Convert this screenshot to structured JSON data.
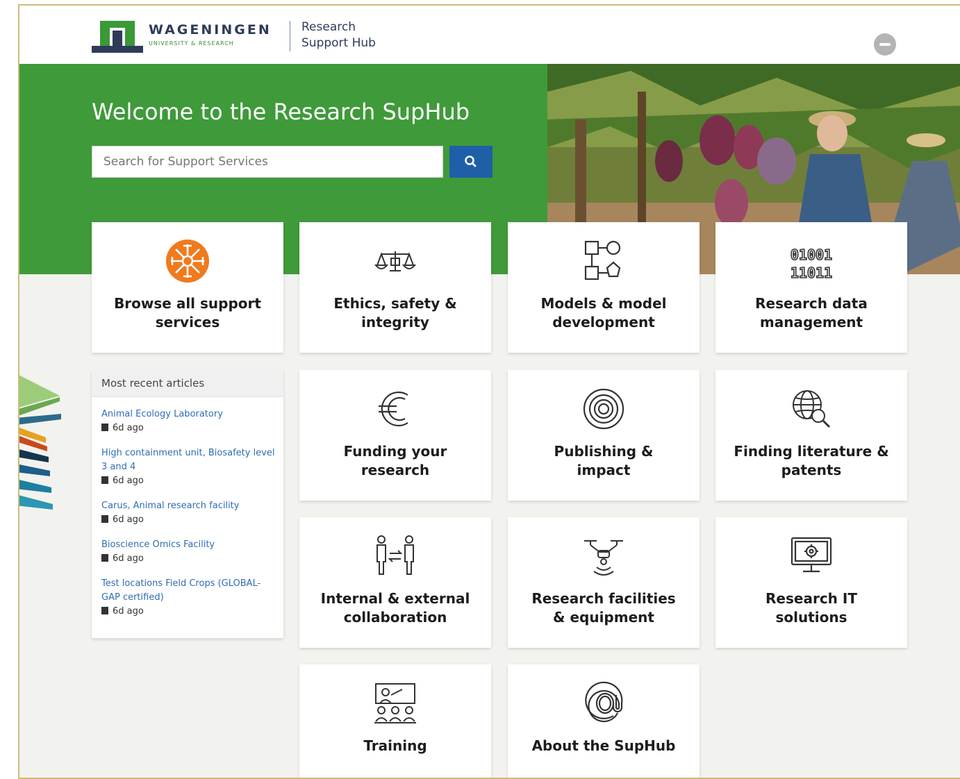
{
  "brand": {
    "name": "WAGENINGEN",
    "sub": "UNIVERSITY & RESEARCH",
    "hub": "Research\nSupport Hub"
  },
  "hero": {
    "title": "Welcome to the Research SupHub",
    "search_placeholder": "Search for Support Services",
    "search_icon": "search-icon"
  },
  "tiles": [
    {
      "label": "Browse all support\nservices",
      "icon": "network-icon"
    },
    {
      "label": "Ethics, safety &\nintegrity",
      "icon": "scales-icon"
    },
    {
      "label": "Models & model\ndevelopment",
      "icon": "model-blocks-icon"
    },
    {
      "label": "Research data\nmanagement",
      "icon": "binary-icon"
    },
    {
      "label": "Funding your\nresearch",
      "icon": "euro-icon"
    },
    {
      "label": "Publishing &\nimpact",
      "icon": "target-icon"
    },
    {
      "label": "Finding literature &\npatents",
      "icon": "globe-search-icon"
    },
    {
      "label": "Internal & external\ncollaboration",
      "icon": "people-exchange-icon"
    },
    {
      "label": "Research facilities\n& equipment",
      "icon": "drone-icon"
    },
    {
      "label": "Research IT\nsolutions",
      "icon": "monitor-gear-icon"
    },
    {
      "label": "Training",
      "icon": "classroom-icon"
    },
    {
      "label": "About the SupHub",
      "icon": "at-sign-icon"
    }
  ],
  "recent": {
    "heading": "Most recent articles",
    "articles": [
      {
        "title": "Animal Ecology Laboratory",
        "age": "6d ago"
      },
      {
        "title": "High containment unit, Biosafety level 3 and 4",
        "age": "6d ago"
      },
      {
        "title": "Carus, Animal research facility",
        "age": "6d ago"
      },
      {
        "title": "Bioscience Omics Facility",
        "age": "6d ago"
      },
      {
        "title": "Test locations Field Crops (GLOBAL-GAP certified)",
        "age": "6d ago"
      }
    ]
  },
  "colors": {
    "green": "#3f9a3a",
    "search_button": "#1f5fa8",
    "link": "#2e6db4",
    "accent_orange": "#f07a1e"
  }
}
